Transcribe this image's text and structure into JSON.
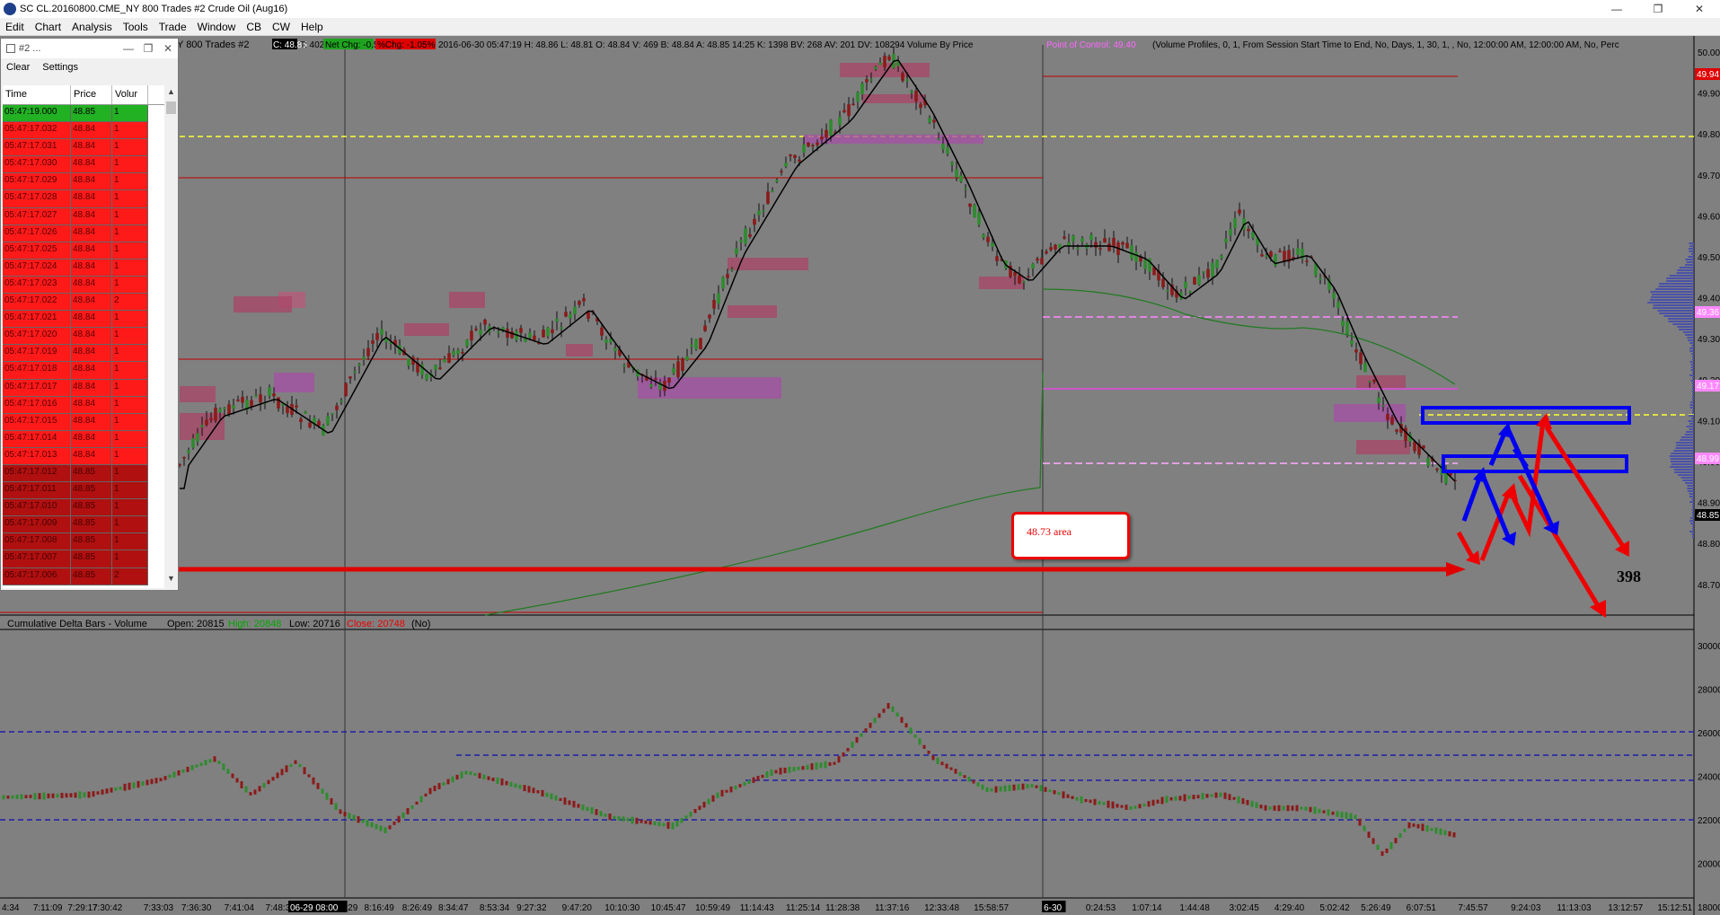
{
  "window": {
    "title": "SC CL.20160800.CME_NY  800 Trades #2  Crude Oil (Aug16)",
    "controls": [
      "—",
      "❐",
      "✕"
    ]
  },
  "menu": [
    "Edit",
    "Chart",
    "Analysis",
    "Tools",
    "Trade",
    "Window",
    "CB",
    "CW",
    "Help"
  ],
  "chart_header": {
    "prefix": "Y  800 Trades #2",
    "c_value": "C: 48.85",
    "t_value": "T: 402",
    "net_chg": "Net Chg: -0.57",
    "pct_chg": "%Chg: -1.05%",
    "ohlc": "2016-06-30 05:47:19  H: 48.86  L: 48.81  O: 48.84  V: 469  B: 48.84  A: 48.85  14:25  K: 1398  BV: 268  AV: 201  DV: 108294  Volume By Price",
    "poc": "Point of Control: 49.40",
    "profile": "(Volume Profiles, 0, 1, From Session Start Time to End, No, Days, 1, 30, 1, , No, 12:00:00 AM, 12:00:00 AM, No, Perc"
  },
  "price_axis": [
    "50.00",
    "49.90",
    "49.80",
    "49.70",
    "49.60",
    "49.50",
    "49.40",
    "49.30",
    "49.20",
    "49.10",
    "49.00",
    "48.90",
    "48.80",
    "48.70"
  ],
  "price_badges": [
    {
      "value": "49.94",
      "bg": "#e00000",
      "color": "#ffffff"
    },
    {
      "value": "49.36",
      "bg": "#ff88ff",
      "color": "#ffffff"
    },
    {
      "value": "49.17",
      "bg": "#ff88ff",
      "color": "#ffffff"
    },
    {
      "value": "48.99",
      "bg": "#ff88ff",
      "color": "#ffffff"
    },
    {
      "value": "48.85",
      "bg": "#000000",
      "color": "#ffffff"
    }
  ],
  "lower_header": {
    "title": "Cumulative Delta Bars - Volume",
    "open": "Open: 20815",
    "high": "High: 20848",
    "low": "Low: 20716",
    "close": "Close: 20748",
    "tail": "(No)"
  },
  "lower_axis": [
    "30000",
    "28000",
    "26000",
    "24000",
    "22000",
    "20000",
    "18000"
  ],
  "time_axis": [
    "4:34",
    "7:11:09",
    "7:29:17",
    "7:30:42",
    "7:33:03",
    "7:36:30",
    "7:41:04",
    "7:48:35",
    "06-29 08:00",
    "29",
    "8:16:49",
    "8:26:49",
    "8:34:47",
    "8:53:34",
    "9:27:32",
    "9:47:20",
    "10:10:30",
    "10:45:47",
    "10:59:49",
    "11:14:43",
    "11:25:14",
    "11:28:38",
    "11:37:16",
    "12:33:48",
    "15:58:57",
    "6-30",
    "0:24:53",
    "1:07:14",
    "1:44:48",
    "3:02:45",
    "4:29:40",
    "5:02:42",
    "5:26:49",
    "6:07:51",
    "7:45:57",
    "9:24:03",
    "11:13:03",
    "13:12:57",
    "15:12:51"
  ],
  "time_and_sales": {
    "title": "#2 ...",
    "toolbar": [
      "Clear",
      "Settings"
    ],
    "columns": [
      "Time",
      "Price",
      "Volur"
    ],
    "rows": [
      {
        "time": "05:47:19.000",
        "price": "48.85",
        "vol": "1",
        "style": "green"
      },
      {
        "time": "05:47:17.032",
        "price": "48.84",
        "vol": "1",
        "style": "red"
      },
      {
        "time": "05:47:17.031",
        "price": "48.84",
        "vol": "1",
        "style": "red"
      },
      {
        "time": "05:47:17.030",
        "price": "48.84",
        "vol": "1",
        "style": "red"
      },
      {
        "time": "05:47:17.029",
        "price": "48.84",
        "vol": "1",
        "style": "red"
      },
      {
        "time": "05:47:17.028",
        "price": "48.84",
        "vol": "1",
        "style": "red"
      },
      {
        "time": "05:47:17.027",
        "price": "48.84",
        "vol": "1",
        "style": "red"
      },
      {
        "time": "05:47:17.026",
        "price": "48.84",
        "vol": "1",
        "style": "red"
      },
      {
        "time": "05:47:17.025",
        "price": "48.84",
        "vol": "1",
        "style": "red"
      },
      {
        "time": "05:47:17.024",
        "price": "48.84",
        "vol": "1",
        "style": "red"
      },
      {
        "time": "05:47:17.023",
        "price": "48.84",
        "vol": "1",
        "style": "red"
      },
      {
        "time": "05:47:17.022",
        "price": "48.84",
        "vol": "2",
        "style": "red"
      },
      {
        "time": "05:47:17.021",
        "price": "48.84",
        "vol": "1",
        "style": "red"
      },
      {
        "time": "05:47:17.020",
        "price": "48.84",
        "vol": "1",
        "style": "red"
      },
      {
        "time": "05:47:17.019",
        "price": "48.84",
        "vol": "1",
        "style": "red"
      },
      {
        "time": "05:47:17.018",
        "price": "48.84",
        "vol": "1",
        "style": "red"
      },
      {
        "time": "05:47:17.017",
        "price": "48.84",
        "vol": "1",
        "style": "red"
      },
      {
        "time": "05:47:17.016",
        "price": "48.84",
        "vol": "1",
        "style": "red"
      },
      {
        "time": "05:47:17.015",
        "price": "48.84",
        "vol": "1",
        "style": "red"
      },
      {
        "time": "05:47:17.014",
        "price": "48.84",
        "vol": "1",
        "style": "red"
      },
      {
        "time": "05:47:17.013",
        "price": "48.84",
        "vol": "1",
        "style": "red"
      },
      {
        "time": "05:47:17.012",
        "price": "48.85",
        "vol": "1",
        "style": "dark"
      },
      {
        "time": "05:47:17.011",
        "price": "48.85",
        "vol": "1",
        "style": "dark"
      },
      {
        "time": "05:47:17.010",
        "price": "48.85",
        "vol": "1",
        "style": "dark"
      },
      {
        "time": "05:47:17.009",
        "price": "48.85",
        "vol": "1",
        "style": "dark"
      },
      {
        "time": "05:47:17.008",
        "price": "48.85",
        "vol": "1",
        "style": "dark"
      },
      {
        "time": "05:47:17.007",
        "price": "48.85",
        "vol": "1",
        "style": "dark"
      },
      {
        "time": "05:47:17.006",
        "price": "48.85",
        "vol": "2",
        "style": "dark"
      }
    ]
  },
  "annotations": {
    "area_label": "48.73 area",
    "count_label": "398"
  },
  "colors": {
    "background": "#808080",
    "bull": "#2e8b2e",
    "bear": "#8b1a1a",
    "arrow_red": "#ee0000",
    "arrow_blue": "#0000ee",
    "sma": "#000000",
    "vwap": "#1f7a1f"
  }
}
